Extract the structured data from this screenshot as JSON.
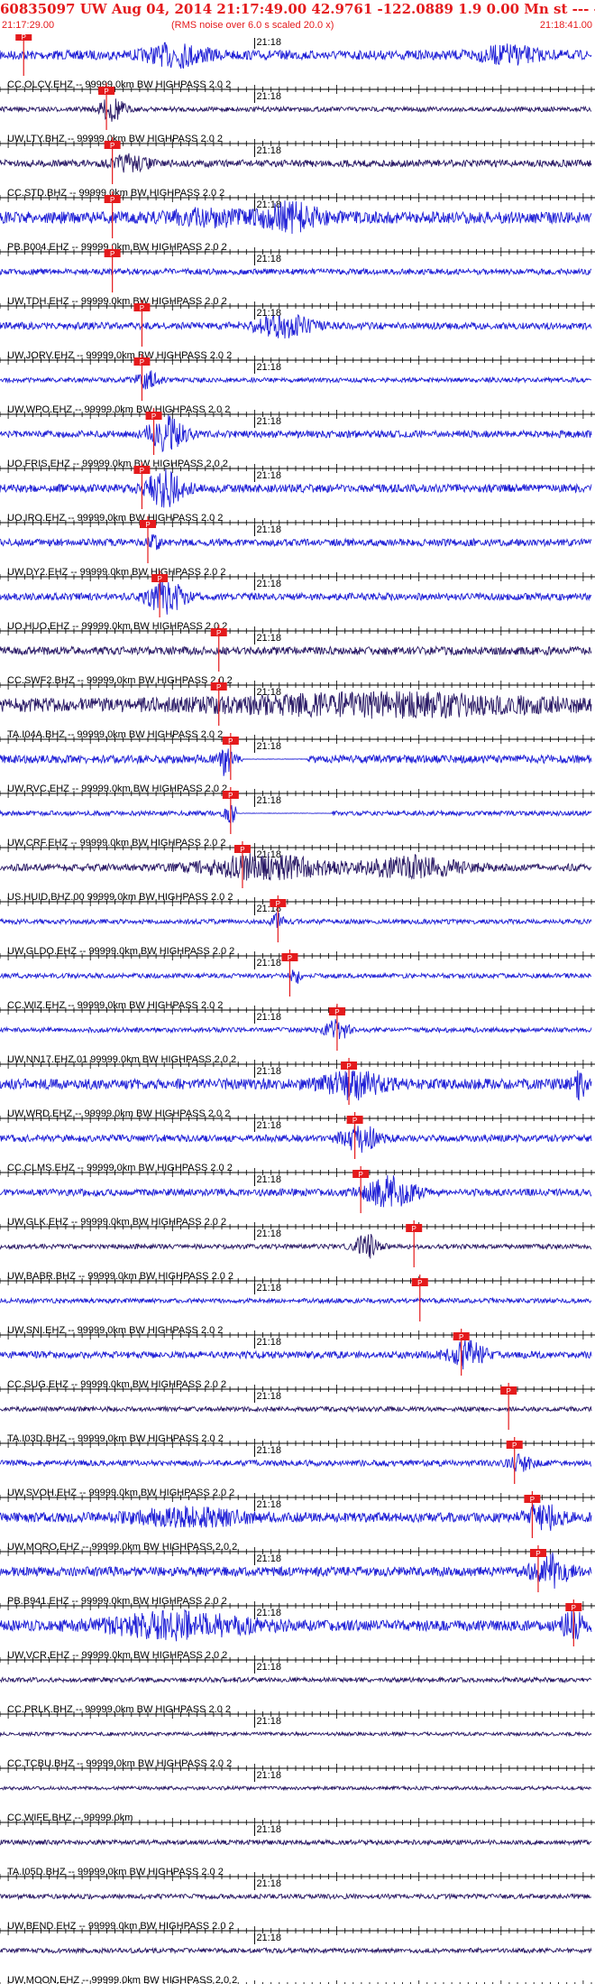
{
  "header": {
    "title": "60835097 UW Aug 04, 2014 21:17:49.00   42.9761 -122.0889  1.9 0.00 Mn st --- -- --   -1",
    "start_time": "21:17:29.00",
    "rms_note": "(RMS noise over 6.0 s scaled 20.0 x)",
    "end_time": "21:18:41.00"
  },
  "chart_data": {
    "type": "line",
    "time_window": [
      "21:17:29.00",
      "21:18:41.00"
    ],
    "tick_label": "21:18",
    "pick_label": "P",
    "colors": {
      "header": "#e41a1c",
      "pick": "#e41a1c",
      "trace_blue": "#1f1fd6",
      "trace_dark": "#2a1a66"
    },
    "traces": [
      {
        "label": "CC.OLCV.EHZ -- 99999.0km BW  HIGHPASS  2.0  2",
        "color": "#1f1fd6",
        "pick": 0.04,
        "amp": 0.4,
        "events": [
          [
            0.3,
            0.05,
            0.8
          ],
          [
            0.86,
            0.05,
            0.6
          ]
        ]
      },
      {
        "label": "UW.LTY.BHZ -- 99999.0km BW  HIGHPASS  2.0  2",
        "color": "#2a1a66",
        "pick": 0.18,
        "amp": 0.2,
        "events": [
          [
            0.19,
            0.02,
            1.0
          ]
        ]
      },
      {
        "label": "CC.STD.BHZ -- 99999.0km BW  HIGHPASS  2.0  2",
        "color": "#2a1a66",
        "pick": 0.19,
        "amp": 0.3,
        "events": [
          [
            0.22,
            0.03,
            0.6
          ]
        ]
      },
      {
        "label": "PB.B004.EHZ -- 99999.0km BW  HIGHPASS  2.0  2",
        "color": "#1f1fd6",
        "pick": 0.19,
        "amp": 0.5,
        "events": [
          [
            0.49,
            0.05,
            1.0
          ],
          [
            0.35,
            0.06,
            0.5
          ]
        ]
      },
      {
        "label": "UW.TDH.EHZ -- 99999.0km BW  HIGHPASS  2.0  2",
        "color": "#1f1fd6",
        "pick": 0.19,
        "amp": 0.25,
        "events": []
      },
      {
        "label": "UW.JORV.EHZ -- 99999.0km BW  HIGHPASS  2.0  2",
        "color": "#1f1fd6",
        "pick": 0.24,
        "amp": 0.3,
        "events": [
          [
            0.48,
            0.05,
            0.8
          ]
        ]
      },
      {
        "label": "UW.WPO.EHZ -- 99999.0km BW  HIGHPASS  2.0  2",
        "color": "#1f1fd6",
        "pick": 0.24,
        "amp": 0.2,
        "events": [
          [
            0.25,
            0.02,
            0.7
          ]
        ]
      },
      {
        "label": "UO.FRIS.EHZ -- 99999.0km BW  HIGHPASS  2.0  2",
        "color": "#1f1fd6",
        "pick": 0.26,
        "amp": 0.3,
        "events": [
          [
            0.28,
            0.03,
            1.4
          ]
        ]
      },
      {
        "label": "UO.IRO.EHZ -- 99999.0km BW  HIGHPASS  2.0  2",
        "color": "#1f1fd6",
        "pick": 0.24,
        "amp": 0.35,
        "events": [
          [
            0.28,
            0.03,
            1.4
          ]
        ]
      },
      {
        "label": "UW.DY2.EHZ -- 99999.0km BW  HIGHPASS  2.0  2",
        "color": "#1f1fd6",
        "pick": 0.25,
        "amp": 0.3,
        "events": [
          [
            0.26,
            0.01,
            0.6
          ]
        ]
      },
      {
        "label": "UO.HUO.EHZ -- 99999.0km BW  HIGHPASS  2.0  2",
        "color": "#1f1fd6",
        "pick": 0.27,
        "amp": 0.3,
        "events": [
          [
            0.28,
            0.03,
            1.3
          ]
        ]
      },
      {
        "label": "CC.SWF2.BHZ -- 99999.0km BW  HIGHPASS  2.0  2",
        "color": "#2a1a66",
        "pick": 0.37,
        "amp": 0.35,
        "events": []
      },
      {
        "label": "TA.I04A.BHZ -- 99999.0km BW  HIGHPASS  2.0  2",
        "color": "#2a1a66",
        "pick": 0.37,
        "amp": 0.6,
        "events": [
          [
            0.65,
            0.25,
            0.6
          ]
        ]
      },
      {
        "label": "UW.RVC.EHZ -- 99999.0km BW  HIGHPASS  2.0  2",
        "color": "#1f1fd6",
        "pick": 0.39,
        "amp": 0.35,
        "events": [
          [
            0.38,
            0.01,
            1.3
          ]
        ],
        "flat": [
          0.41,
          0.52
        ]
      },
      {
        "label": "UW.CRF.EHZ -- 99999.0km BW  HIGHPASS  2.0  2",
        "color": "#1f1fd6",
        "pick": 0.39,
        "amp": 0.2,
        "events": [
          [
            0.39,
            0.01,
            0.8
          ]
        ],
        "flat": [
          0.4,
          0.56
        ]
      },
      {
        "label": "US.HUID.BHZ.00 99999.0km BW  HIGHPASS  2.0  2",
        "color": "#2a1a66",
        "pick": 0.41,
        "amp": 0.3,
        "events": [
          [
            0.45,
            0.1,
            1.0
          ],
          [
            0.7,
            0.08,
            0.8
          ]
        ]
      },
      {
        "label": "UW.GLDO.EHZ -- 99999.0km BW  HIGHPASS  2.0  2",
        "color": "#1f1fd6",
        "pick": 0.47,
        "amp": 0.2,
        "events": [
          [
            0.47,
            0.01,
            0.6
          ]
        ]
      },
      {
        "label": "CC.WIZ.EHZ -- 99999.0km BW  HIGHPASS  2.0  2",
        "color": "#1f1fd6",
        "pick": 0.49,
        "amp": 0.2,
        "events": [
          [
            0.5,
            0.01,
            0.7
          ]
        ]
      },
      {
        "label": "UW.NN17.EHZ.01 99999.0km BW  HIGHPASS  2.0  2",
        "color": "#1f1fd6",
        "pick": 0.57,
        "amp": 0.2,
        "events": [
          [
            0.57,
            0.02,
            0.8
          ]
        ]
      },
      {
        "label": "UW.WRD.EHZ -- 99999.0km BW  HIGHPASS  2.0  2",
        "color": "#1f1fd6",
        "pick": 0.59,
        "amp": 0.45,
        "events": [
          [
            0.6,
            0.05,
            1.0
          ],
          [
            0.98,
            0.01,
            1.0
          ]
        ]
      },
      {
        "label": "CC.CLMS.EHZ -- 99999.0km BW  HIGHPASS  2.0  2",
        "color": "#1f1fd6",
        "pick": 0.6,
        "amp": 0.3,
        "events": [
          [
            0.61,
            0.03,
            1.0
          ]
        ]
      },
      {
        "label": "UW.GLK.EHZ -- 99999.0km BW  HIGHPASS  2.0  2",
        "color": "#1f1fd6",
        "pick": 0.61,
        "amp": 0.3,
        "events": [
          [
            0.66,
            0.04,
            1.2
          ]
        ]
      },
      {
        "label": "UW.BABR.BHZ -- 99999.0km BW  HIGHPASS  2.0  2",
        "color": "#2a1a66",
        "pick": 0.7,
        "amp": 0.2,
        "events": [
          [
            0.62,
            0.02,
            1.0
          ]
        ]
      },
      {
        "label": "UW.SNI.EHZ -- 99999.0km BW  HIGHPASS  2.0  2",
        "color": "#1f1fd6",
        "pick": 0.71,
        "amp": 0.2,
        "events": []
      },
      {
        "label": "CC.SUG.EHZ -- 99999.0km BW  HIGHPASS  2.0  2",
        "color": "#1f1fd6",
        "pick": 0.78,
        "amp": 0.3,
        "events": [
          [
            0.79,
            0.03,
            1.0
          ]
        ]
      },
      {
        "label": "TA.I03D.BHZ -- 99999.0km BW  HIGHPASS  2.0  2",
        "color": "#2a1a66",
        "pick": 0.86,
        "amp": 0.2,
        "events": []
      },
      {
        "label": "UW.SVOH.EHZ -- 99999.0km BW  HIGHPASS  2.0  2",
        "color": "#1f1fd6",
        "pick": 0.87,
        "amp": 0.25,
        "events": [
          [
            0.88,
            0.02,
            0.7
          ]
        ]
      },
      {
        "label": "UW.MORO.EHZ -- 99999.0km BW  HIGHPASS  2.0  2",
        "color": "#1f1fd6",
        "pick": 0.9,
        "amp": 0.4,
        "events": [
          [
            0.32,
            0.1,
            0.6
          ],
          [
            0.92,
            0.03,
            1.0
          ]
        ]
      },
      {
        "label": "PB.B941.EHZ -- 99999.0km BW  HIGHPASS  2.0  2",
        "color": "#1f1fd6",
        "pick": 0.91,
        "amp": 0.4,
        "events": [
          [
            0.93,
            0.03,
            1.3
          ]
        ]
      },
      {
        "label": "UW.VCR.EHZ -- 99999.0km BW  HIGHPASS  2.0  2",
        "color": "#1f1fd6",
        "pick": 0.97,
        "amp": 0.45,
        "events": [
          [
            0.3,
            0.12,
            0.9
          ],
          [
            0.97,
            0.02,
            1.0
          ]
        ]
      },
      {
        "label": "CC.PRLK.BHZ -- 99999.0km BW  HIGHPASS  2.0  2",
        "color": "#2a1a66",
        "pick": null,
        "amp": 0.2,
        "events": []
      },
      {
        "label": "CC.TCBU.BHZ -- 99999.0km BW  HIGHPASS  2.0  2",
        "color": "#2a1a66",
        "pick": null,
        "amp": 0.15,
        "events": []
      },
      {
        "label": "CC.WIFE.BHZ -- 99999.0km",
        "color": "#2a1a66",
        "pick": null,
        "amp": 0.15,
        "events": []
      },
      {
        "label": "TA.I05D.BHZ -- 99999.0km BW  HIGHPASS  2.0  2",
        "color": "#2a1a66",
        "pick": null,
        "amp": 0.2,
        "events": []
      },
      {
        "label": "UW.BEND.EHZ -- 99999.0km BW  HIGHPASS  2.0  2",
        "color": "#2a1a66",
        "pick": null,
        "amp": 0.2,
        "events": []
      },
      {
        "label": "UW.MOON.EHZ -- 99999.0km BW  HIGHPASS  2.0  2",
        "color": "#2a1a66",
        "pick": null,
        "amp": 0.2,
        "events": []
      }
    ]
  }
}
